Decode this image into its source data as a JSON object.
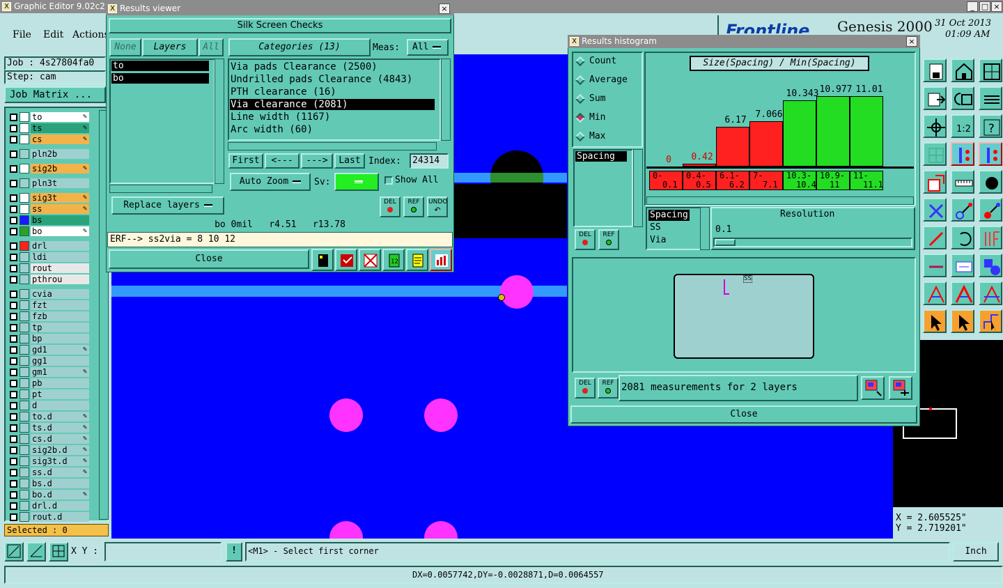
{
  "main_window": {
    "title": "Graphic Editor 9.02c2 (",
    "menu": [
      "File",
      "Edit",
      "Actions"
    ],
    "job_label": "Job : 4s27804fa0",
    "step_label": "Step: cam",
    "job_matrix": "Job Matrix ...",
    "selected": "Selected : 0",
    "brand": "Genesis 2000",
    "brand_partial": "Frontline",
    "date": "31 Oct 2013",
    "time": "01:09 AM",
    "coord_x": "X = 2.605525\"",
    "coord_y": "Y = 2.719201\"",
    "xy_label": "X Y :",
    "xy_value": "",
    "prompt": "<M1> - Select first corner",
    "units": "Inch",
    "status": "DX=0.0057742,DY=-0.0028871,D=0.0064557",
    "window_buttons": [
      "_",
      "□",
      "×"
    ]
  },
  "layers": [
    {
      "name": "to",
      "color": "#ffffff",
      "swatch": "#ffffff",
      "mark": true
    },
    {
      "name": "ts",
      "color": "#2aa37a",
      "swatch": "#ffffff",
      "mark": true
    },
    {
      "name": "cs",
      "color": "#f3b34a",
      "swatch": "#ffffff",
      "mark": true
    },
    {
      "name": "pln2b",
      "color": "#9fd0d0",
      "swatch": "#9fd0d0",
      "mark": false
    },
    {
      "name": "sig2b",
      "color": "#f3b34a",
      "swatch": "#ffffff",
      "mark": true
    },
    {
      "name": "pln3t",
      "color": "#9fd0d0",
      "swatch": "#9fd0d0",
      "mark": false
    },
    {
      "name": "sig3t",
      "color": "#f3b34a",
      "swatch": "#ffffff",
      "mark": true
    },
    {
      "name": "ss",
      "color": "#f3b34a",
      "swatch": "#ffffff",
      "mark": true
    },
    {
      "name": "bs",
      "color": "#2aa37a",
      "swatch": "#1a1aff",
      "mark": false
    },
    {
      "name": "bo",
      "color": "#ffffff",
      "swatch": "#2d9f2d",
      "mark": true
    },
    {
      "name": "drl",
      "color": "#9fd0d0",
      "swatch": "#ff2020",
      "mark": false
    },
    {
      "name": "ldi",
      "color": "#9fd0d0",
      "swatch": "#9fd0d0",
      "mark": false
    },
    {
      "name": "rout",
      "color": "#e8e8e8",
      "swatch": "#9fd0d0",
      "mark": false
    },
    {
      "name": "pthrou",
      "color": "#e8e8e8",
      "swatch": "#9fd0d0",
      "mark": false
    },
    {
      "name": "cvia",
      "color": "#9fd0d0",
      "swatch": "#9fd0d0",
      "mark": false
    },
    {
      "name": "fzt",
      "color": "#9fd0d0",
      "swatch": "#9fd0d0",
      "mark": false
    },
    {
      "name": "fzb",
      "color": "#9fd0d0",
      "swatch": "#9fd0d0",
      "mark": false
    },
    {
      "name": "tp",
      "color": "#9fd0d0",
      "swatch": "#9fd0d0",
      "mark": false
    },
    {
      "name": "bp",
      "color": "#9fd0d0",
      "swatch": "#9fd0d0",
      "mark": false
    },
    {
      "name": "gd1",
      "color": "#9fd0d0",
      "swatch": "#9fd0d0",
      "mark": true
    },
    {
      "name": "gg1",
      "color": "#9fd0d0",
      "swatch": "#9fd0d0",
      "mark": false
    },
    {
      "name": "gm1",
      "color": "#9fd0d0",
      "swatch": "#9fd0d0",
      "mark": true
    },
    {
      "name": "pb",
      "color": "#9fd0d0",
      "swatch": "#9fd0d0",
      "mark": false
    },
    {
      "name": "pt",
      "color": "#9fd0d0",
      "swatch": "#9fd0d0",
      "mark": false
    },
    {
      "name": "d",
      "color": "#9fd0d0",
      "swatch": "#9fd0d0",
      "mark": false
    },
    {
      "name": "to.d",
      "color": "#9fd0d0",
      "swatch": "#9fd0d0",
      "mark": true
    },
    {
      "name": "ts.d",
      "color": "#9fd0d0",
      "swatch": "#9fd0d0",
      "mark": true
    },
    {
      "name": "cs.d",
      "color": "#9fd0d0",
      "swatch": "#9fd0d0",
      "mark": true
    },
    {
      "name": "sig2b.d",
      "color": "#9fd0d0",
      "swatch": "#9fd0d0",
      "mark": true
    },
    {
      "name": "sig3t.d",
      "color": "#9fd0d0",
      "swatch": "#9fd0d0",
      "mark": true
    },
    {
      "name": "ss.d",
      "color": "#9fd0d0",
      "swatch": "#9fd0d0",
      "mark": true
    },
    {
      "name": "bs.d",
      "color": "#9fd0d0",
      "swatch": "#9fd0d0",
      "mark": false
    },
    {
      "name": "bo.d",
      "color": "#9fd0d0",
      "swatch": "#9fd0d0",
      "mark": true
    },
    {
      "name": "drl.d",
      "color": "#9fd0d0",
      "swatch": "#9fd0d0",
      "mark": false
    },
    {
      "name": "rout.d",
      "color": "#9fd0d0",
      "swatch": "#9fd0d0",
      "mark": false
    }
  ],
  "results_viewer": {
    "title": "Results viewer",
    "header": "Silk Screen Checks",
    "filter_none": "None",
    "filter_layers": "Layers",
    "filter_all": "All",
    "categories_label": "Categories (13)",
    "meas_label": "Meas:",
    "meas_value": "All",
    "layer_list": [
      "to",
      "bo"
    ],
    "categories": [
      "Via pads Clearance (2500)",
      "Undrilled pads Clearance (4843)",
      "PTH clearance (16)",
      "Via clearance (2081)",
      "Line width (1167)",
      "Arc width (60)"
    ],
    "selected_category": 3,
    "nav_first": "First",
    "nav_prev": "<---",
    "nav_next": "--->",
    "nav_last": "Last",
    "index_label": "Index:",
    "index_value": "24314",
    "auto_zoom": "Auto Zoom",
    "sv_label": "Sv:",
    "show_all": "Show All",
    "replace_layers": "Replace layers",
    "info_line": "bo 0mil   r4.51   r13.78",
    "erf_line": "ERF--> ss2via = 8 10 12",
    "close": "Close",
    "icon_del": "DEL",
    "icon_ref": "REF",
    "icon_undo": "UNDO"
  },
  "histogram": {
    "title": "Results histogram",
    "chart_title": "Size(Spacing) / Min(Spacing)",
    "modes": [
      "Count",
      "Average",
      "Sum",
      "Min",
      "Max"
    ],
    "selected_mode": "Min",
    "measure_list": [
      "Spacing"
    ],
    "bottom_list": [
      "Spacing",
      "SS",
      "Via"
    ],
    "resolution_label": "Resolution",
    "resolution_value": "0.1",
    "summary": "2081 measurements for 2 layers",
    "close": "Close",
    "icon_del": "DEL",
    "icon_ref": "REF",
    "preview_mark": "SS",
    "colors": {
      "fail": "#ff2020",
      "pass": "#22dd22"
    }
  },
  "chart_data": {
    "type": "bar",
    "title": "Size(Spacing) / Min(Spacing)",
    "categories": [
      "0-0.1",
      "0.4-0.5",
      "6.1-6.2",
      "7-7.1",
      "10.3-10.4",
      "10.9-11",
      "11-11.1"
    ],
    "category_labels_top": [
      "0-",
      "0.4-",
      "6.1-",
      "7-",
      "10.3-",
      "10.9-",
      "11-"
    ],
    "category_labels_bottom": [
      "0.1",
      "0.5",
      "6.2",
      "7.1",
      "10.4",
      "11",
      "11.1"
    ],
    "values": [
      0,
      0.42,
      6.17,
      7.066,
      10.343,
      10.977,
      11.01
    ],
    "value_labels": [
      "0",
      "0.42",
      "6.17",
      "7.066",
      "10.343",
      "10.977",
      "11.01"
    ],
    "status": [
      "fail",
      "fail",
      "fail",
      "fail",
      "pass",
      "pass",
      "pass"
    ],
    "ylim": [
      0,
      12
    ]
  }
}
